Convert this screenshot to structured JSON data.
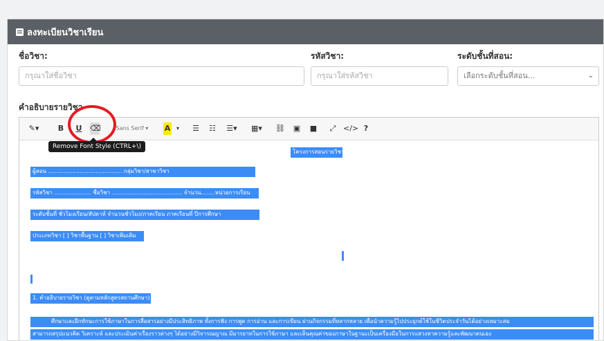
{
  "header": {
    "title": "ลงทะเบียนวิชาเรียน",
    "icon": "form-icon"
  },
  "fields": {
    "course_name": {
      "label": "ชื่อวิชา:",
      "placeholder": "กรุณาใส่ชื่อวิชา"
    },
    "course_code": {
      "label": "รหัสวิชา:",
      "placeholder": "กรุณาใส่รหัสวิชา"
    },
    "level": {
      "label": "ระดับชั้นที่สอน:",
      "selected": "เลือกระดับชั้นที่สอน...",
      "caret": "⌄"
    }
  },
  "description": {
    "label": "คำอธิบายรายวิชา"
  },
  "toolbar": {
    "magic": "✎▾",
    "bold": "B",
    "underline": "U",
    "eraser": "⌫",
    "font": "Sans Serif ▾",
    "color": "A",
    "color_caret": "▾",
    "ul": "☰",
    "ol": "☷",
    "align": "☰▾",
    "table": "▦▾",
    "link": "⛓",
    "image": "▣",
    "video": "■",
    "fullscreen": "⤢",
    "code": "</>",
    "help": "?"
  },
  "tooltip": "Remove Font Style (CTRL+\\)",
  "content": {
    "heading": "โครงการสอนรายวิชา",
    "line1": "ผู้สอน  ..........................................  กลุ่มวิชา/สาขาวิชา",
    "line2": "รหัสวิชา ..................... ชื่อวิชา ........................................ จำนวน........หน่วยการเรียน",
    "line3": "ระดับชั้นที่        ชั่วโมงเรียน/สัปดาห์           จำนวนชั่วโมง/ภาคเรียน          ภาคเรียนที่           ปีการศึกษา",
    "line4": "ประเภทวิชา   [  ] วิชาพื้นฐาน   [  ] วิชาเพิ่มเติม",
    "section": "1. คำอธิบายรายวิชา (ดูตามหลักสูตรสถานศึกษา)",
    "para1": "ศึกษาและฝึกทักษะการใช้ภาษาในการสื่อสารอย่างมีประสิทธิภาพ ทั้งการฟัง การพูด การอ่าน และการเขียน ผ่านกิจกรรมที่หลากหลาย เพื่อนำความรู้ไปประยุกต์ใช้ในชีวิตประจำวันได้อย่างเหมาะสม",
    "para2": "สามารถสรุปแนวคิด วิเคราะห์ และประเมินค่าเรื่องราวต่างๆ ได้อย่างมีวิจารณญาณ มีมารยาทในการใช้ภาษา และเห็นคุณค่าของภาษาในฐานะเป็นเครื่องมือในการแสวงหาความรู้และพัฒนาตนเอง"
  }
}
